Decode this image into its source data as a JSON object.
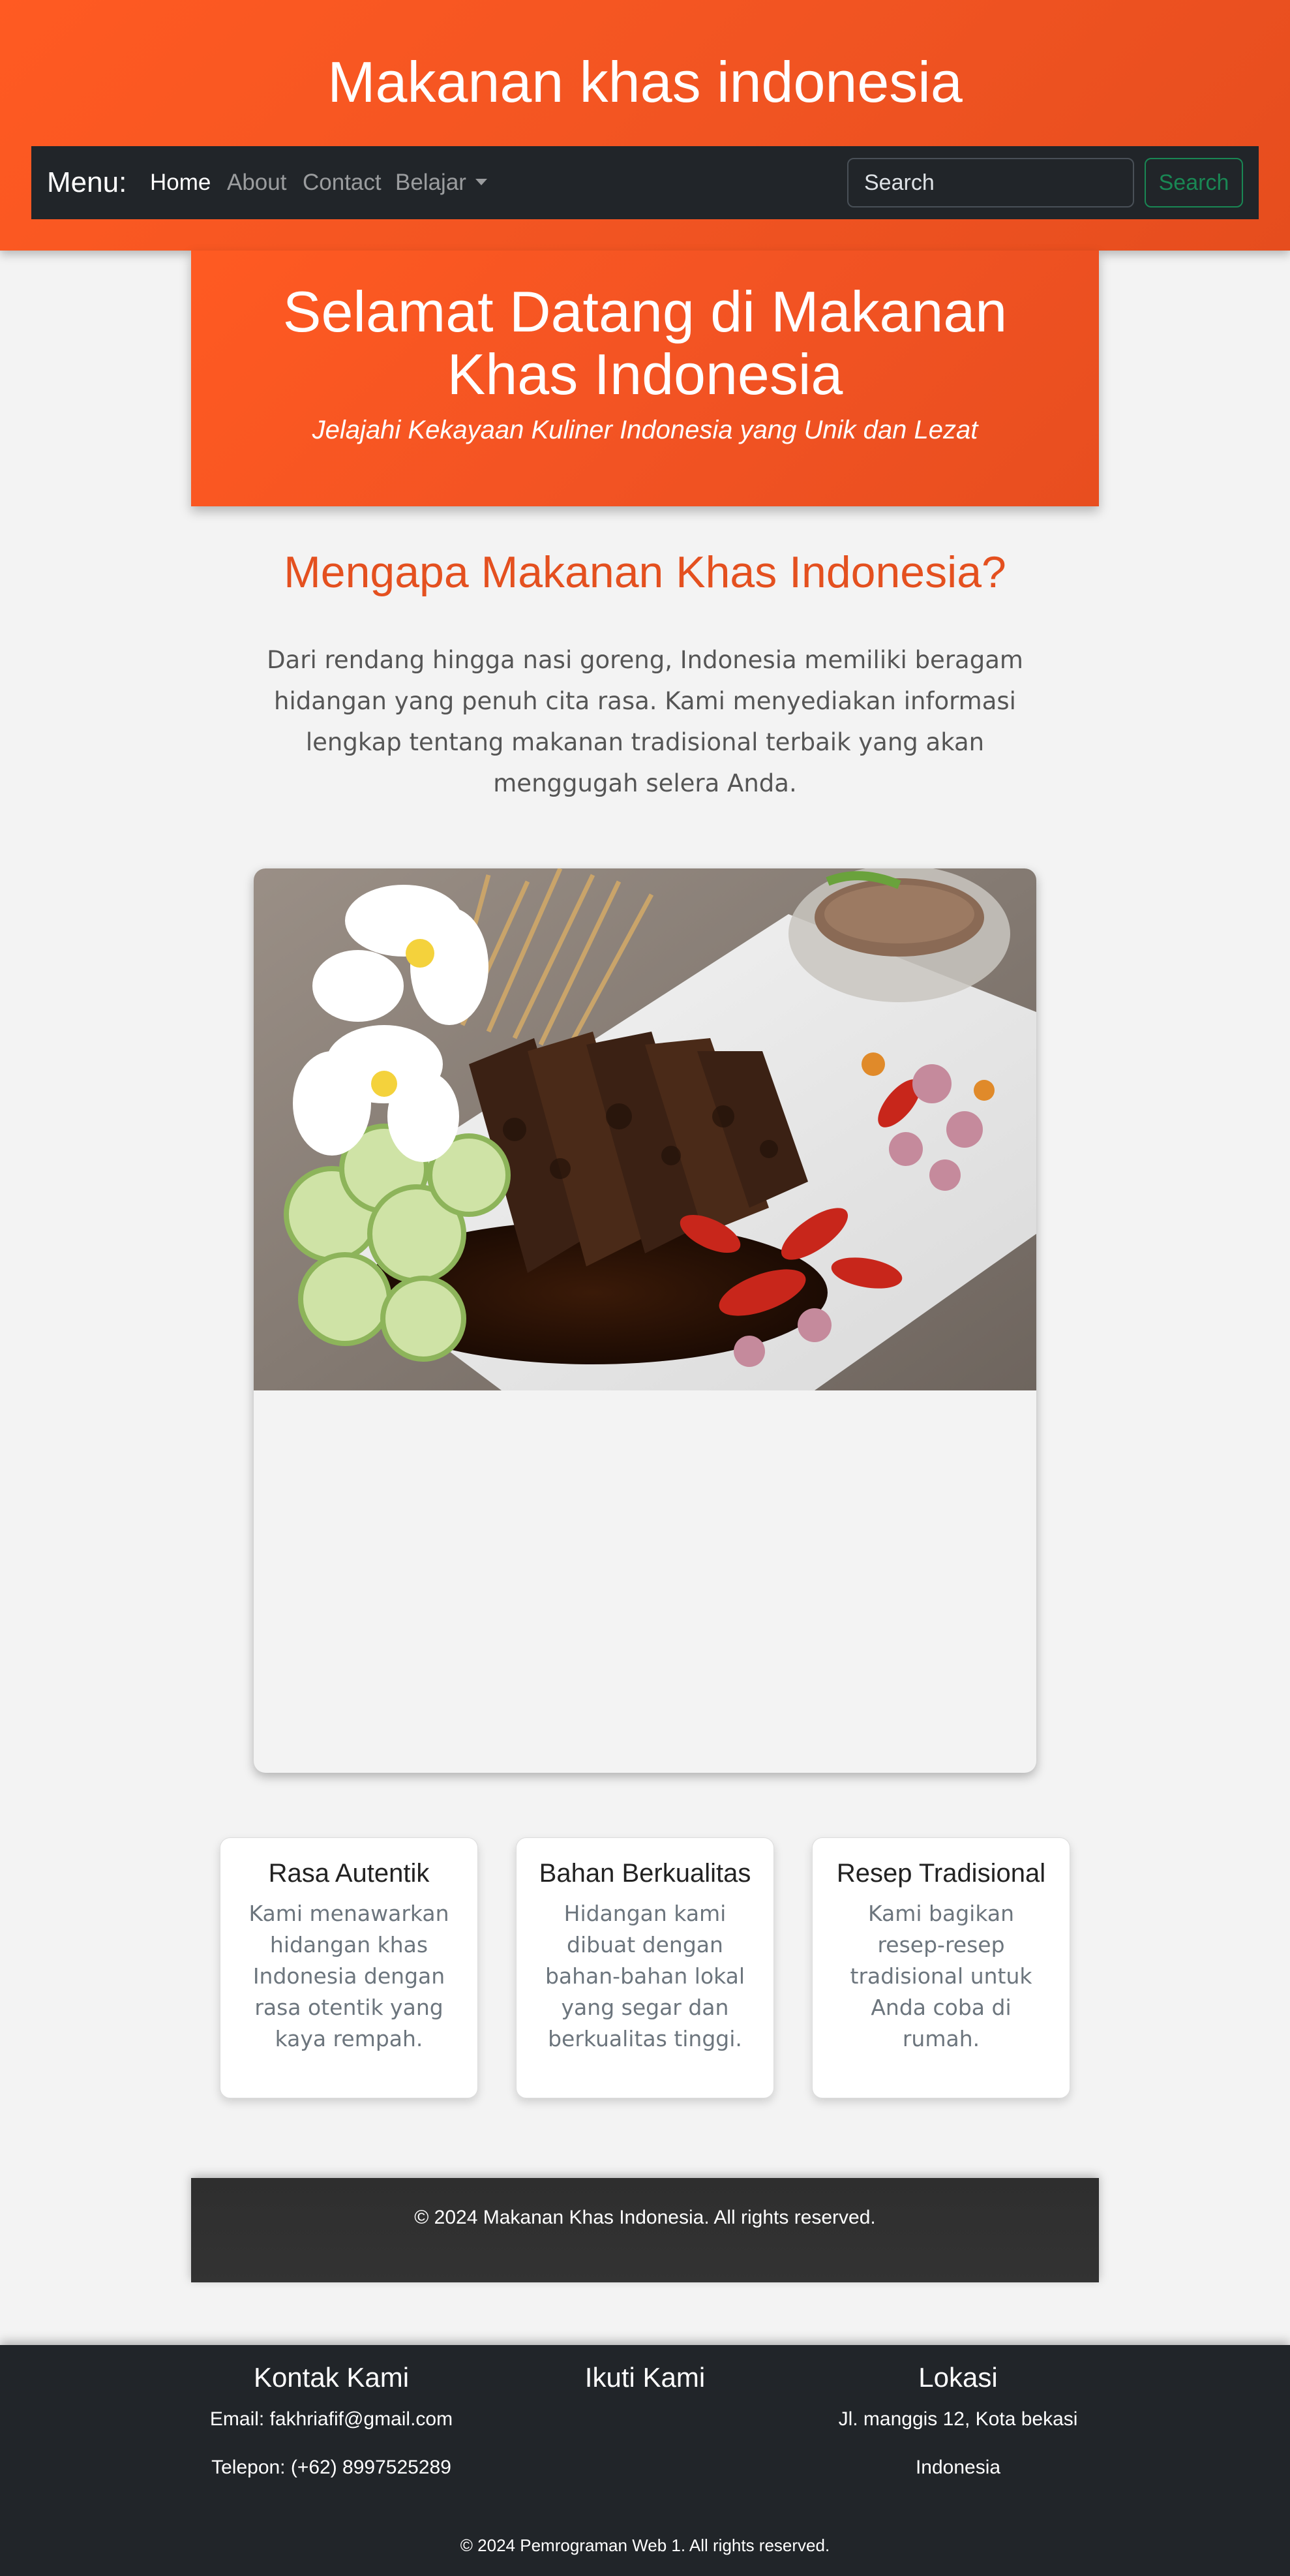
{
  "header": {
    "site_title": "Makanan khas indonesia"
  },
  "navbar": {
    "brand": "Menu:",
    "links": [
      {
        "label": "Home",
        "active": true
      },
      {
        "label": "About",
        "active": false
      },
      {
        "label": "Contact",
        "active": false
      },
      {
        "label": "Belajar",
        "active": false,
        "dropdown": true
      }
    ],
    "search": {
      "placeholder": "Search",
      "button_label": "Search"
    }
  },
  "hero": {
    "title": "Selamat Datang di Makanan Khas Indonesia",
    "subtitle": "Jelajahi Kekayaan Kuliner Indonesia yang Unik dan Lezat"
  },
  "why": {
    "title": "Mengapa Makanan Khas Indonesia?",
    "text": "Dari rendang hingga nasi goreng, Indonesia memiliki beragam hidangan yang penuh cita rasa. Kami menyediakan informasi lengkap tentang makanan tradisional terbaik yang akan menggugah selera Anda."
  },
  "features": [
    {
      "title": "Rasa Autentik",
      "text": "Kami menawarkan hidangan khas Indonesia dengan rasa otentik yang kaya rempah."
    },
    {
      "title": "Bahan Berkualitas",
      "text": "Hidangan kami dibuat dengan bahan-bahan lokal yang segar dan berkualitas tinggi."
    },
    {
      "title": "Resep Tradisional",
      "text": "Kami bagikan resep-resep tradisional untuk Anda coba di rumah."
    }
  ],
  "inner_footer": {
    "copyright": "© 2024 Makanan Khas Indonesia. All rights reserved."
  },
  "footer": {
    "contact": {
      "title": "Kontak Kami",
      "email": "Email: fakhriafif@gmail.com",
      "phone": "Telepon: (+62) 8997525289"
    },
    "follow": {
      "title": "Ikuti Kami"
    },
    "location": {
      "title": "Lokasi",
      "address": "Jl. manggis 12, Kota bekasi",
      "country": "Indonesia"
    },
    "copyright": "© 2024 Pemrograman Web 1. All rights reserved."
  },
  "colors": {
    "brand_orange": "#f15422",
    "navbar_dark": "#212529",
    "search_green": "#198754",
    "heading_orange": "#e4501f"
  }
}
